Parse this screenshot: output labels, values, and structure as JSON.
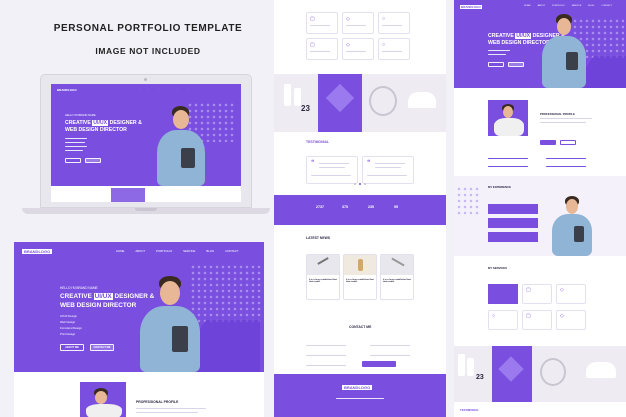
{
  "heading": {
    "title": "PERSONAL PORTFOLIO TEMPLATE",
    "subtitle": "IMAGE NOT INCLUDED"
  },
  "brand": {
    "logo": "BRANDLOGO"
  },
  "nav": [
    "HOME",
    "ABOUT",
    "PORTFOLIO",
    "SERVICE",
    "BLOG",
    "CONTACT"
  ],
  "hero": {
    "kicker": "HELLO I'M BRAND NAME",
    "line1_prefix": "CREATIVE ",
    "line1_highlight": "UI/UX",
    "line1_suffix": " DESIGNER &",
    "line2": "WEB DESIGN DIRECTOR",
    "bullets": [
      "UI/UX Design",
      "Web Design",
      "Front-End Design",
      "Print Design"
    ],
    "btn_primary": "ABOUT ME",
    "btn_secondary": "CONTACT ME"
  },
  "sections": {
    "profile": "PROFESSIONAL PROFILE",
    "testimonial": "TESTIMONIAL",
    "latest_news": "LATEST NEWS",
    "contact": "CONTACT ME",
    "experience": "MY EXPERIENCE",
    "services": "MY SERVICES"
  },
  "portfolio_number": "23",
  "stats": [
    "2737",
    "375",
    "235",
    "95"
  ],
  "news_titles": [
    "It is a long established fact that reader",
    "It is a long established fact that reader",
    "It is a long established fact that reader"
  ],
  "colors": {
    "accent": "#7a4fe0",
    "accent_dark": "#6a3fd6",
    "background": "#f3f1f8"
  }
}
